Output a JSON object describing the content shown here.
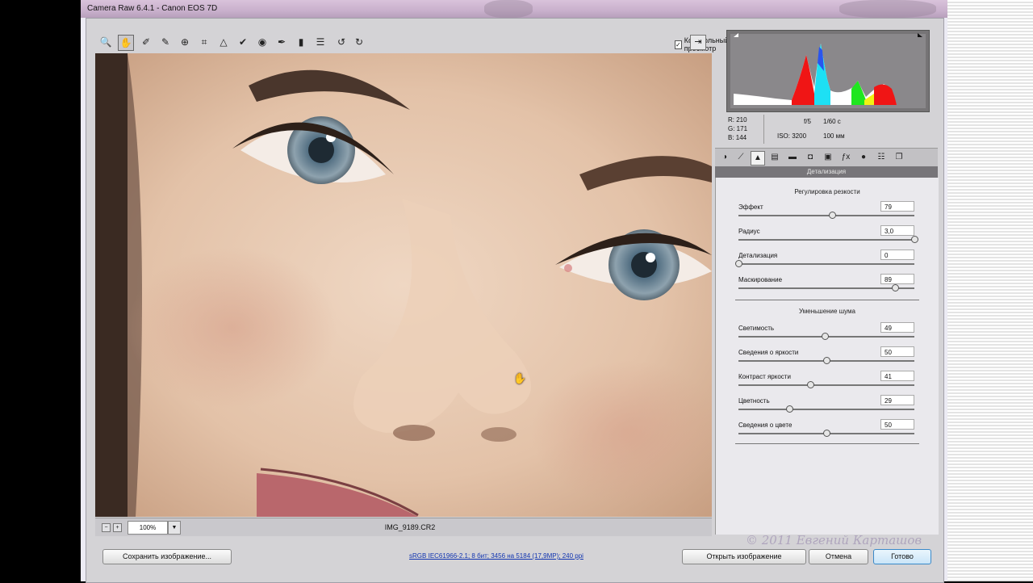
{
  "window": {
    "title": "Camera Raw 6.4.1  -  Canon EOS 7D"
  },
  "toolbar": {
    "tools": [
      {
        "icon": "zoom-icon",
        "glyph": "🔍"
      },
      {
        "icon": "hand-icon",
        "glyph": "✋"
      },
      {
        "icon": "white-balance-icon",
        "glyph": "✐"
      },
      {
        "icon": "color-sampler-icon",
        "glyph": "✎"
      },
      {
        "icon": "target-adjust-icon",
        "glyph": "⊕"
      },
      {
        "icon": "crop-icon",
        "glyph": "⌗"
      },
      {
        "icon": "straighten-icon",
        "glyph": "△"
      },
      {
        "icon": "spot-removal-icon",
        "glyph": "✔"
      },
      {
        "icon": "red-eye-icon",
        "glyph": "◉"
      },
      {
        "icon": "adjustment-brush-icon",
        "glyph": "✒"
      },
      {
        "icon": "graduated-filter-icon",
        "glyph": "▮"
      },
      {
        "icon": "preferences-icon",
        "glyph": "☰"
      },
      {
        "icon": "rotate-left-icon",
        "glyph": "↺"
      },
      {
        "icon": "rotate-right-icon",
        "glyph": "↻"
      }
    ],
    "preview_label": "Контрольный просмотр",
    "preview_checked": "✓"
  },
  "image_status": {
    "zoom": "100%",
    "filename": "IMG_9189.CR2"
  },
  "readout": {
    "r": "R:  210",
    "g": "G:  171",
    "b": "B:  144",
    "aperture": "f/5",
    "shutter": "1/60 с",
    "iso": "ISO: 3200",
    "focal": "100 мм"
  },
  "panel": {
    "title": "Детализация",
    "sharpening_title": "Регулировка резкости",
    "noise_title": "Уменьшение шума",
    "sharpening": [
      {
        "label": "Эффект",
        "value": "79",
        "fraction": 0.53
      },
      {
        "label": "Радиус",
        "value": "3,0",
        "fraction": 1.0
      },
      {
        "label": "Детализация",
        "value": "0",
        "fraction": 0.0
      },
      {
        "label": "Маскирование",
        "value": "89",
        "fraction": 0.89
      }
    ],
    "noise": [
      {
        "label": "Светимость",
        "value": "49",
        "fraction": 0.49
      },
      {
        "label": "Сведения о яркости",
        "value": "50",
        "fraction": 0.5
      },
      {
        "label": "Контраст яркости",
        "value": "41",
        "fraction": 0.41
      },
      {
        "label": "Цветность",
        "value": "29",
        "fraction": 0.29
      },
      {
        "label": "Сведения о цвете",
        "value": "50",
        "fraction": 0.5
      }
    ]
  },
  "footer": {
    "save_label": "Сохранить изображение...",
    "info_link": "sRGB IEC61966-2.1; 8 бит; 3456 на 5184 (17,9МР); 240 ppi",
    "open_label": "Открыть изображение",
    "cancel_label": "Отмена",
    "done_label": "Готово",
    "watermark": "© 2011 Евгений Карташов"
  }
}
